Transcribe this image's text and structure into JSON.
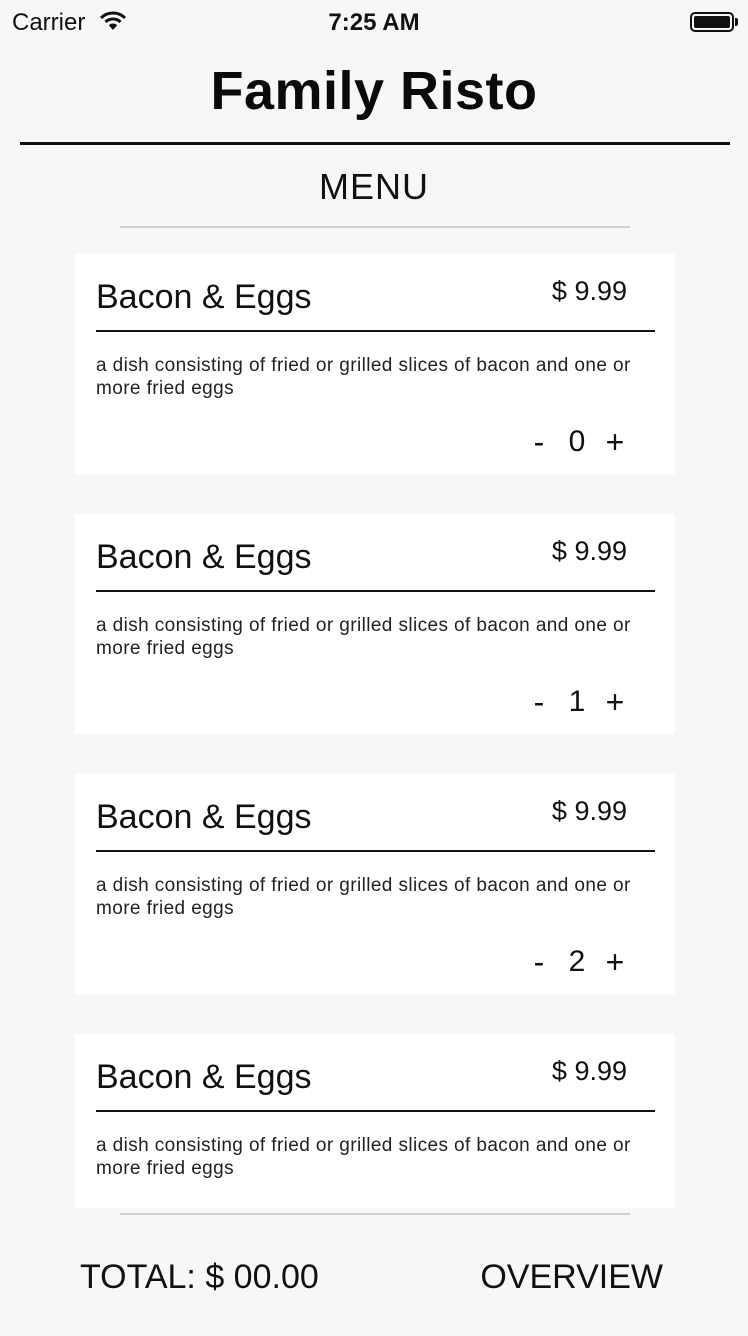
{
  "status_bar": {
    "carrier": "Carrier",
    "time": "7:25 AM"
  },
  "header": {
    "title": "Family Risto",
    "section": "MENU"
  },
  "menu_items": [
    {
      "name": "Bacon & Eggs",
      "price": "$ 9.99",
      "description": "a dish consisting of fried or grilled slices of bacon and one or more fried eggs",
      "minus": "-",
      "quantity": "0",
      "plus": "+"
    },
    {
      "name": "Bacon & Eggs",
      "price": "$ 9.99",
      "description": "a dish consisting of fried or grilled slices of bacon and one or more fried eggs",
      "minus": "-",
      "quantity": "1",
      "plus": "+"
    },
    {
      "name": "Bacon & Eggs",
      "price": "$ 9.99",
      "description": "a dish consisting of fried or grilled slices of bacon and one or more fried eggs",
      "minus": "-",
      "quantity": "2",
      "plus": "+"
    },
    {
      "name": "Bacon & Eggs",
      "price": "$ 9.99",
      "description": "a dish consisting of fried or grilled slices of bacon and one or more fried eggs"
    }
  ],
  "footer": {
    "total": "TOTAL: $ 00.00",
    "overview": "OVERVIEW"
  },
  "icons": {
    "wifi": "wifi-icon",
    "battery": "battery-icon"
  },
  "colors": {
    "background": "#f8f7f5",
    "card": "#ffffff",
    "text": "#111111",
    "divider": "#cfcfcf"
  }
}
